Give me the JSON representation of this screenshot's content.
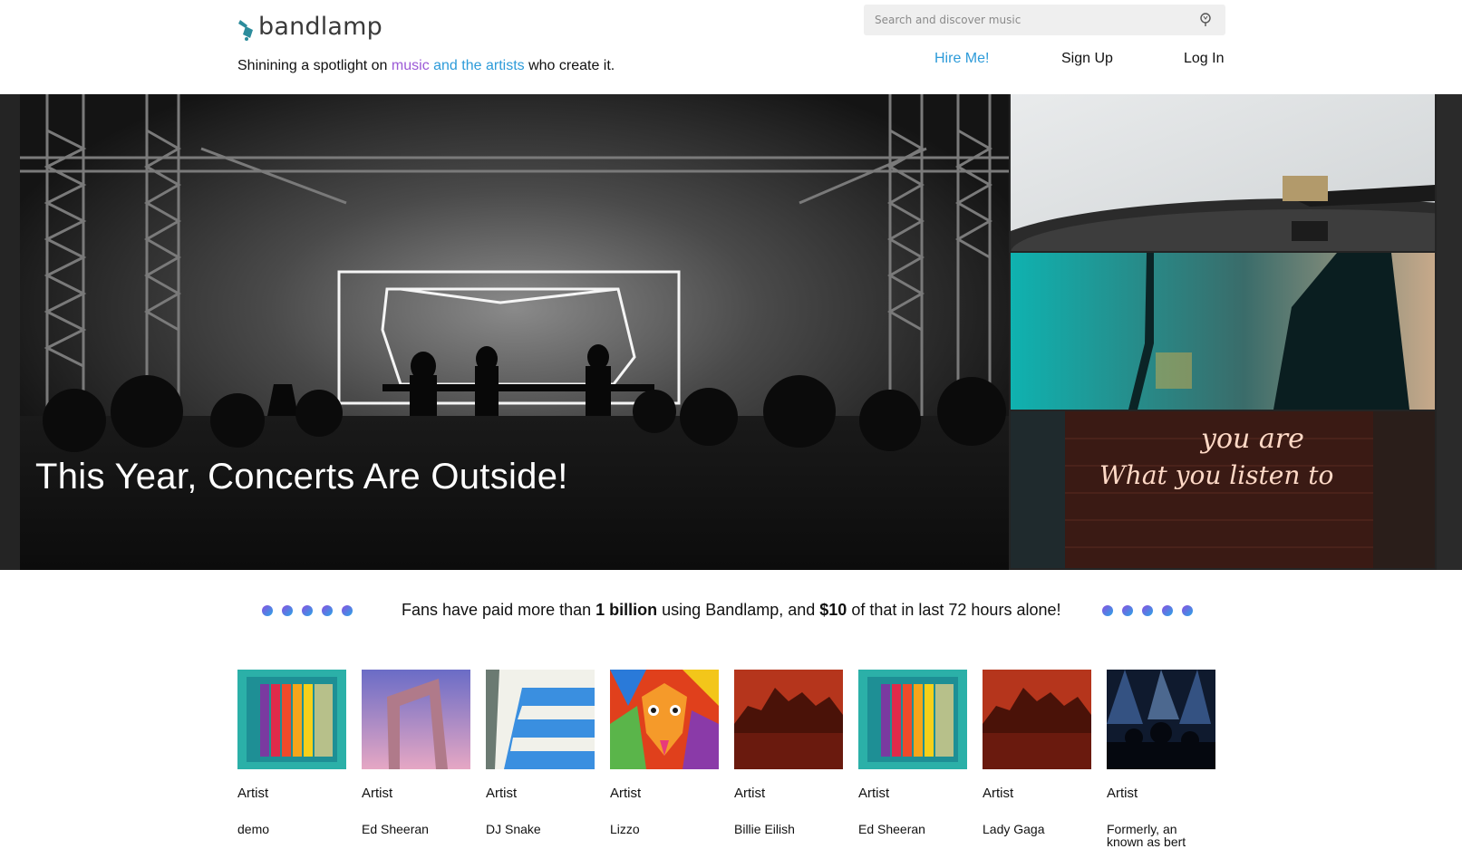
{
  "header": {
    "logo_text": "bandlamp",
    "tagline": {
      "before": "Shinining a spotlight on ",
      "music": "music",
      "middle": " and the ",
      "artists": "artists",
      "after": " who create it."
    },
    "search": {
      "placeholder": "Search and discover music"
    },
    "nav": {
      "hire": "Hire Me!",
      "signup": "Sign Up",
      "login": "Log In"
    }
  },
  "hero": {
    "title": "This Year, Concerts Are Outside!",
    "neon_line1": "you are",
    "neon_line2": "What you listen to"
  },
  "stats": {
    "before": "Fans have paid more than ",
    "amount_total": "1 billion",
    "middle": " using Bandlamp, and ",
    "amount_recent": "$10",
    "after": " of that in last 72 hours alone!"
  },
  "artists": [
    {
      "role": "Artist",
      "name": "demo"
    },
    {
      "role": "Artist",
      "name": "Ed Sheeran"
    },
    {
      "role": "Artist",
      "name": "DJ Snake"
    },
    {
      "role": "Artist",
      "name": "Lizzo"
    },
    {
      "role": "Artist",
      "name": "Billie Eilish"
    },
    {
      "role": "Artist",
      "name": "Ed Sheeran"
    },
    {
      "role": "Artist",
      "name": "Lady Gaga"
    },
    {
      "role": "Artist",
      "name": "Formerly, an known as bert"
    }
  ],
  "colors": {
    "accent_blue": "#2d9bd9",
    "accent_purple": "#9b59d6"
  },
  "icons": {
    "search": "search-icon",
    "logo": "lamp-logo-icon"
  }
}
